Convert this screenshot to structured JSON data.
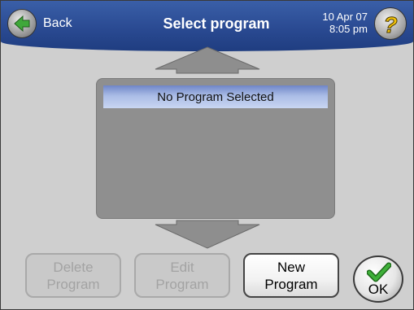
{
  "header": {
    "back_label": "Back",
    "title": "Select program",
    "date": "10 Apr 07",
    "time": "8:05 pm",
    "help_symbol": "?"
  },
  "list": {
    "items": [
      {
        "label": "No Program Selected",
        "selected": true
      }
    ]
  },
  "buttons": {
    "delete": {
      "label": "Delete\nProgram",
      "enabled": false
    },
    "edit": {
      "label": "Edit\nProgram",
      "enabled": false
    },
    "new": {
      "label": "New\nProgram",
      "enabled": true
    },
    "ok": {
      "label": "OK"
    }
  },
  "icons": {
    "back": "back-arrow-icon",
    "help": "question-mark-icon",
    "scroll_up": "scroll-up-arrow-icon",
    "scroll_down": "scroll-down-arrow-icon",
    "ok": "checkmark-icon"
  },
  "colors": {
    "header": "#2a4a92",
    "back_arrow": "#3fa83a",
    "help_mark": "#f2c20a",
    "selection": "#aabce6",
    "check": "#2f9a2a"
  }
}
